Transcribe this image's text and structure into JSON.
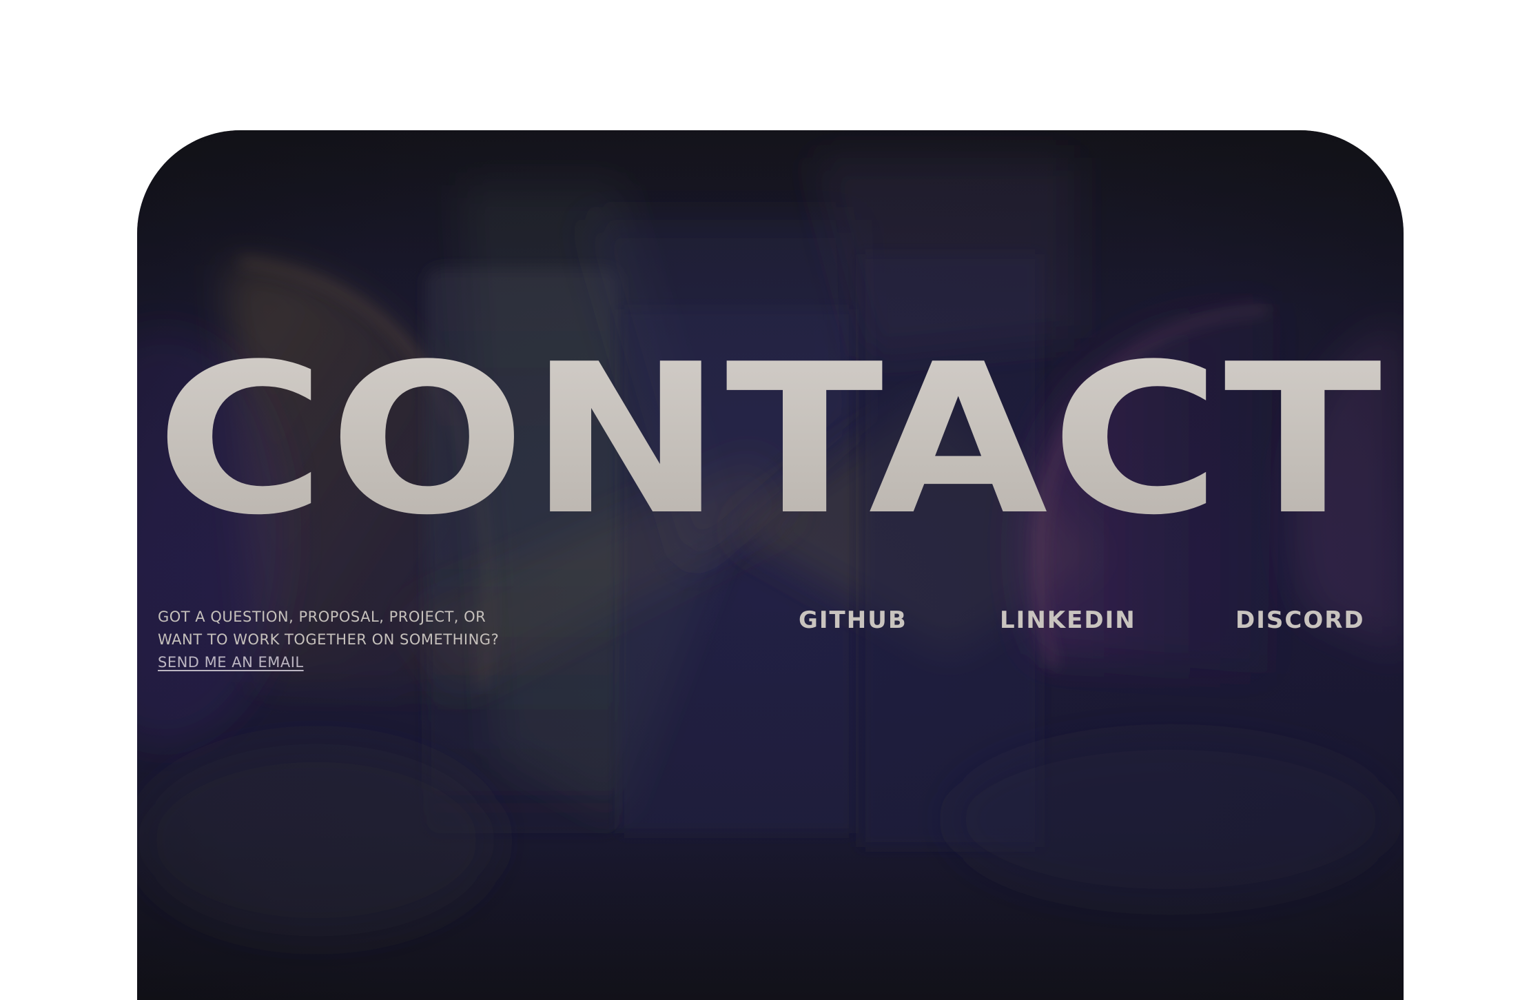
{
  "contact": {
    "title": "CONTACT",
    "intro_line_1": "GOT A QUESTION, PROPOSAL, PROJECT, OR",
    "intro_line_2": "WANT TO WORK TOGETHER ON SOMETHING?",
    "email_link": "SEND ME AN EMAIL",
    "socials": {
      "github": "GITHUB",
      "linkedin": "LINKEDIN",
      "discord": "DISCORD"
    }
  },
  "colors": {
    "page_background": "#ffffff",
    "card_background": "#1e1b3c",
    "text": "#c9c4bf"
  }
}
